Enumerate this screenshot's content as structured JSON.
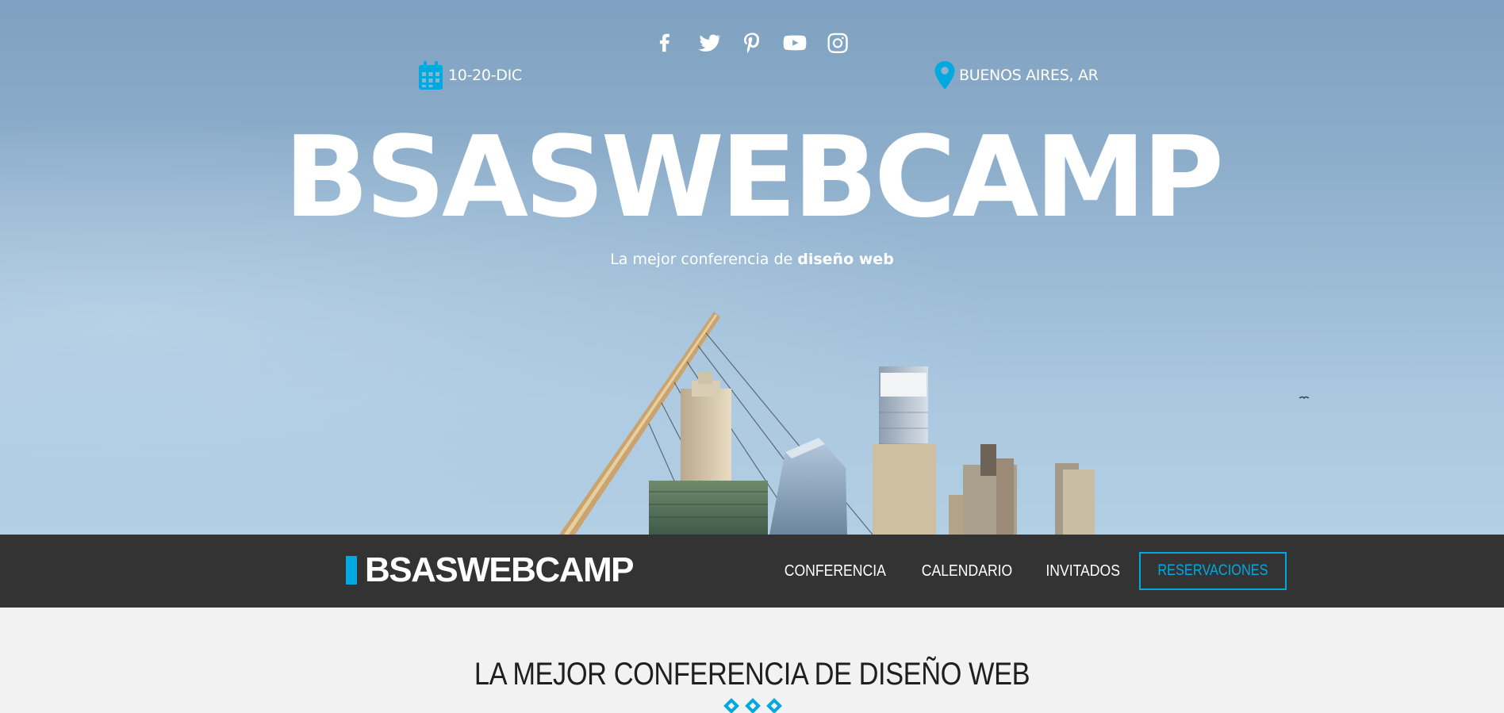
{
  "hero": {
    "social_icons": [
      {
        "icon": "facebook-icon"
      },
      {
        "icon": "twitter-icon"
      },
      {
        "icon": "pinterest-icon"
      },
      {
        "icon": "youtube-icon"
      },
      {
        "icon": "instagram-icon"
      }
    ],
    "date": "10-20-DIC",
    "location": "BUENOS AIRES, AR",
    "title": "BSASWEBCAMP",
    "subtitle_prefix": "La mejor conferencia de ",
    "subtitle_bold": "diseño web"
  },
  "navbar": {
    "logo": "BSASWEBCAMP",
    "links": [
      "CONFERENCIA",
      "CALENDARIO",
      "INVITADOS"
    ],
    "cta": "RESERVACIONES"
  },
  "main": {
    "section_title": "LA MEJOR CONFERENCIA DE DISEÑO WEB"
  },
  "colors": {
    "accent": "#02a8e0",
    "navbar": "#333333",
    "page_bg": "#f2f2f2"
  }
}
